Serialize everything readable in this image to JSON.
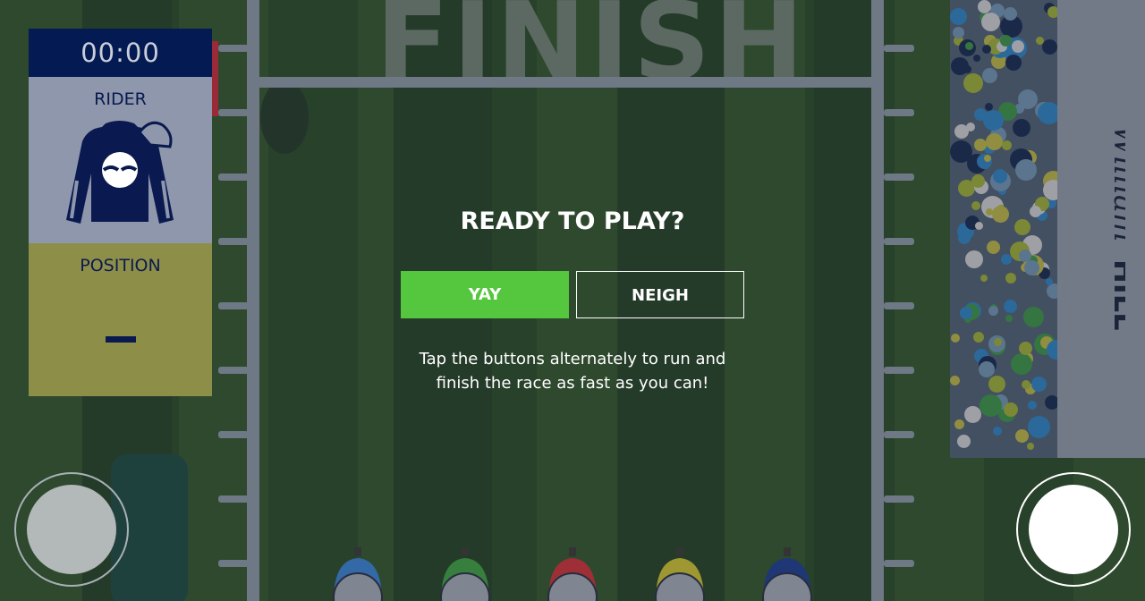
{
  "track": {
    "finish_text": "FINISH",
    "sponsor": "William HILL"
  },
  "hud": {
    "timer": "00:00",
    "rider_label": "RIDER",
    "position_label": "POSITION",
    "position_value": "–"
  },
  "dialog": {
    "title": "READY TO PLAY?",
    "yay_label": "YAY",
    "neigh_label": "NEIGH",
    "instructions_line1": "Tap the buttons alternately to run and",
    "instructions_line2": "finish the race as fast as you can!"
  },
  "controls": {
    "left_button": "tap-left",
    "right_button": "tap-right"
  },
  "jockeys": [
    {
      "color": "#3a7fd0",
      "icon": "hands-icon"
    },
    {
      "color": "#3e9d45",
      "icon": "handshake-icon"
    },
    {
      "color": "#c8323d",
      "icon": "fist-icon"
    },
    {
      "color": "#c9bd36",
      "icon": "tree-icon"
    },
    {
      "color": "#1f3c8f",
      "icon": "star-icon"
    }
  ],
  "colors": {
    "timer_bg": "#041a52",
    "rider_bg": "#8e97ab",
    "position_bg": "#8d8f48",
    "yay_button": "#54c73e"
  }
}
